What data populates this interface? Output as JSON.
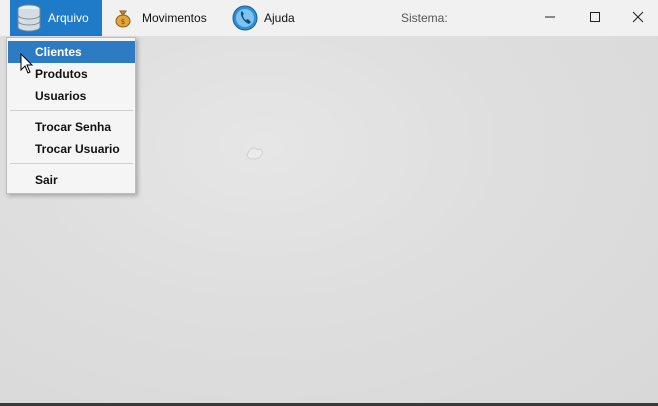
{
  "menubar": {
    "arquivo": {
      "label": "Arquivo",
      "icon": "database-icon"
    },
    "movimentos": {
      "label": "Movimentos",
      "icon": "money-bag-icon"
    },
    "ajuda": {
      "label": "Ajuda",
      "icon": "phone-icon"
    },
    "sistema_label": "Sistema:"
  },
  "window_controls": {
    "minimize": "minimize-icon",
    "maximize": "maximize-icon",
    "close": "close-icon"
  },
  "dropdown": {
    "items": [
      {
        "label": "Clientes",
        "highlighted": true
      },
      {
        "label": "Produtos"
      },
      {
        "label": "Usuarios"
      },
      {
        "label": "Trocar Senha"
      },
      {
        "label": "Trocar Usuario"
      },
      {
        "label": "Sair"
      }
    ]
  },
  "colors": {
    "accent": "#1f7ac8",
    "hover": "#2d7cc3",
    "menubar": "#f1f1f1",
    "background": "#dcdcdc"
  }
}
